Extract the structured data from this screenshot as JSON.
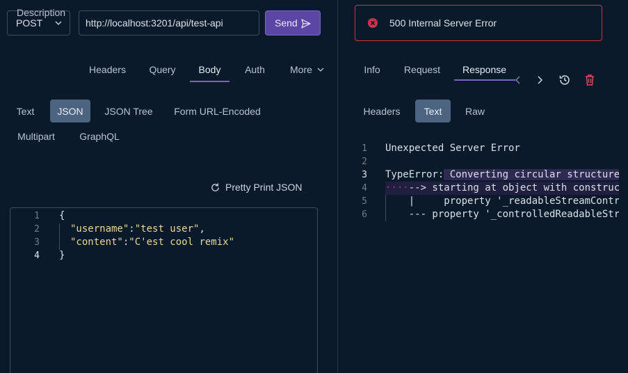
{
  "request": {
    "method": "POST",
    "url": "http://localhost:3201/api/test-api",
    "send_label": "Send"
  },
  "request_tabs": [
    "Description",
    "Headers",
    "Query",
    "Body",
    "Auth",
    "More"
  ],
  "active_request_tab": "Body",
  "body_types": [
    "Text",
    "JSON",
    "JSON Tree",
    "Form URL-Encoded",
    "Multipart",
    "GraphQL"
  ],
  "active_body_type": "JSON",
  "pretty_print_label": "Pretty Print JSON",
  "editor": {
    "line_numbers": [
      "1",
      "2",
      "3",
      "4"
    ],
    "lines": {
      "l1": "{",
      "l2_key": "\"username\"",
      "l2_sep": ":",
      "l2_val": "\"test user\"",
      "l2_end": ",",
      "l3_key": "\"content\"",
      "l3_sep": ":",
      "l3_val": "\"C'est cool remix\"",
      "l4": "}"
    }
  },
  "status": {
    "text": "500 Internal Server Error",
    "color": "#c9344a"
  },
  "response_tabs": [
    "Info",
    "Request",
    "Response"
  ],
  "active_response_tab": "Response",
  "response_view_tabs": [
    "Headers",
    "Text",
    "Raw"
  ],
  "active_response_view_tab": "Text",
  "response_body": {
    "line_numbers": [
      "1",
      "2",
      "3",
      "4",
      "5",
      "6"
    ],
    "l1": "Unexpected Server Error",
    "l3_a": "TypeError:",
    "l3_b": " Converting circular structure",
    "l4_dots": "····",
    "l4_rest": "--> starting at object with construc",
    "l5": "    |     property '_readableStreamContr",
    "l6": "    --- property '_controlledReadableStr"
  },
  "colors": {
    "accent": "#7a66c6",
    "send_bg": "#5b46a6",
    "error": "#c9344a",
    "active_pill": "#4c6480",
    "background": "#0b1a2a"
  }
}
